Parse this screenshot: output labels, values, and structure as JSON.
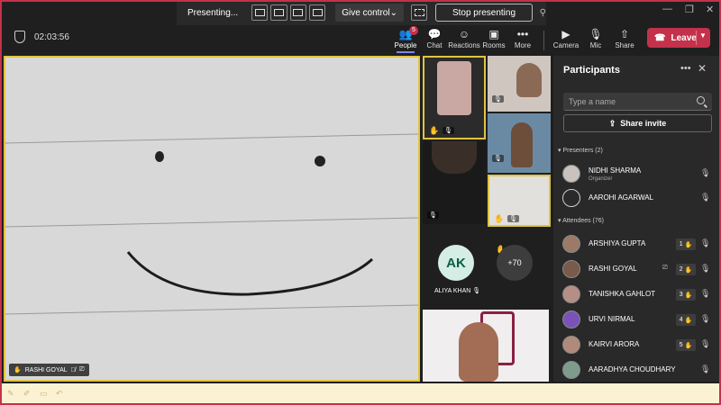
{
  "presenting_bar": {
    "status": "Presenting...",
    "give_control": "Give control",
    "stop_presenting": "Stop presenting"
  },
  "meeting": {
    "timer": "02:03:56",
    "toolbar": [
      {
        "label": "People",
        "icon": "people-icon",
        "badge": "5"
      },
      {
        "label": "Chat",
        "icon": "chat-icon"
      },
      {
        "label": "Reactions",
        "icon": "reactions-icon"
      },
      {
        "label": "Rooms",
        "icon": "rooms-icon"
      },
      {
        "label": "More",
        "icon": "more-icon"
      },
      {
        "label": "Camera",
        "icon": "camera-icon"
      },
      {
        "label": "Mic",
        "icon": "mic-icon"
      },
      {
        "label": "Share",
        "icon": "share-icon"
      }
    ],
    "leave": "Leave"
  },
  "stage": {
    "presenter_name": "RASHI GOYAL"
  },
  "tiles": {
    "avatar_initials": "AK",
    "avatar_name": "ALIYA KHAN",
    "overflow_count": "+70"
  },
  "participants": {
    "title": "Participants",
    "search_placeholder": "Type a name",
    "share_invite": "Share invite",
    "presenters_header": "Presenters (2)",
    "presenters": [
      {
        "name": "NIDHI SHARMA",
        "role": "Organizer"
      },
      {
        "name": "AAROHI AGARWAL"
      }
    ],
    "attendees_header": "Attendees (76)",
    "attendees": [
      {
        "name": "ARSHIYA GUPTA",
        "hand": "1"
      },
      {
        "name": "RASHI GOYAL",
        "hand": "2"
      },
      {
        "name": "TANISHKA GAHLOT",
        "hand": "3"
      },
      {
        "name": "URVI NIRMAL",
        "hand": "4"
      },
      {
        "name": "KAIRVI ARORA",
        "hand": "5"
      },
      {
        "name": "AARADHYA CHOUDHARY"
      }
    ]
  },
  "colors": {
    "accent": "#7f85f5",
    "leave": "#c4314b",
    "highlight": "#e0c441"
  }
}
